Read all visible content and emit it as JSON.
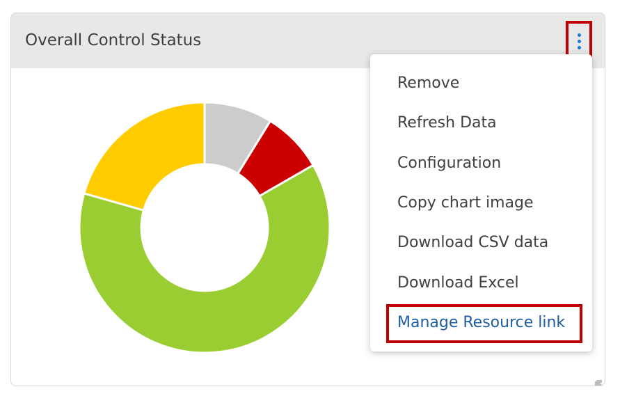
{
  "card": {
    "title": "Overall Control Status"
  },
  "icons": {
    "menu": "more-vertical-icon",
    "resize": "resize-diagonal-icon"
  },
  "menu": {
    "items": [
      "Remove",
      "Refresh Data",
      "Configuration",
      "Copy chart image",
      "Download CSV data",
      "Download Excel",
      "Manage Resource link"
    ],
    "highlighted": "Manage Resource link"
  },
  "colors": {
    "highlight_border": "#c00000",
    "link": "#1f5e9e",
    "kebab": "#1a7ad4"
  },
  "chart_data": {
    "type": "pie",
    "donut": true,
    "start": "top",
    "direction": "clockwise",
    "values": [
      8.8,
      7.9,
      62.7,
      20.6
    ],
    "colors": [
      "#cccccc",
      "#cc0000",
      "#9acd32",
      "#ffcc00"
    ]
  }
}
